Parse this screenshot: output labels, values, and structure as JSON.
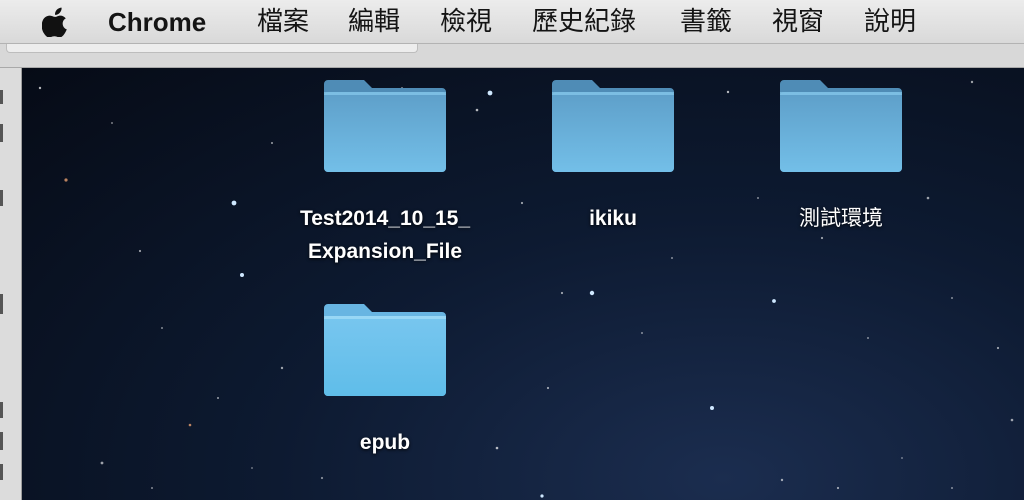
{
  "menubar": {
    "app_name": "Chrome",
    "items": [
      {
        "label": "檔案"
      },
      {
        "label": "編輯"
      },
      {
        "label": "檢視"
      },
      {
        "label": "歷史紀錄"
      },
      {
        "label": "書籤"
      },
      {
        "label": "視窗"
      },
      {
        "label": "說明"
      }
    ]
  },
  "desktop": {
    "folders": [
      {
        "name_line1": "Test2014_10_15_",
        "name_line2": "Expansion_File",
        "icon": "folder-icon"
      },
      {
        "name_line1": "ikiku",
        "icon": "folder-icon"
      },
      {
        "name_line1": "測試環境",
        "icon": "folder-icon"
      },
      {
        "name_line1": "epub",
        "icon": "folder-icon"
      }
    ]
  },
  "colors": {
    "folder_light": "#7cc7ef",
    "folder_dark": "#5fa9d6",
    "menubar_bg": "#e6e6e6",
    "desktop_bg": "#0b1426"
  }
}
